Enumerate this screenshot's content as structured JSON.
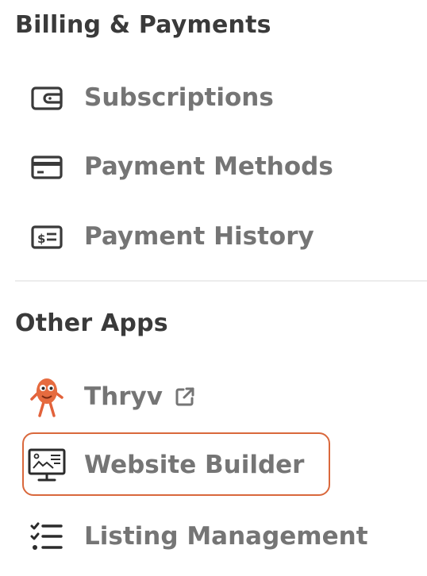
{
  "billing": {
    "title": "Billing & Payments",
    "items": [
      {
        "label": "Subscriptions",
        "icon": "wallet-icon"
      },
      {
        "label": "Payment Methods",
        "icon": "credit-card-icon"
      },
      {
        "label": "Payment History",
        "icon": "receipt-dollar-icon"
      }
    ]
  },
  "other_apps": {
    "title": "Other Apps",
    "items": [
      {
        "label": "Thryv",
        "icon": "thryv-mascot-icon",
        "external": true,
        "external_icon": "external-link-icon"
      },
      {
        "label": "Website Builder",
        "icon": "website-monitor-icon",
        "selected": true
      },
      {
        "label": "Listing Management",
        "icon": "checklist-icon"
      }
    ]
  },
  "colors": {
    "title_text": "#3a3a3a",
    "item_text": "#757575",
    "highlight_border": "#d9683c",
    "divider": "#ececec"
  }
}
